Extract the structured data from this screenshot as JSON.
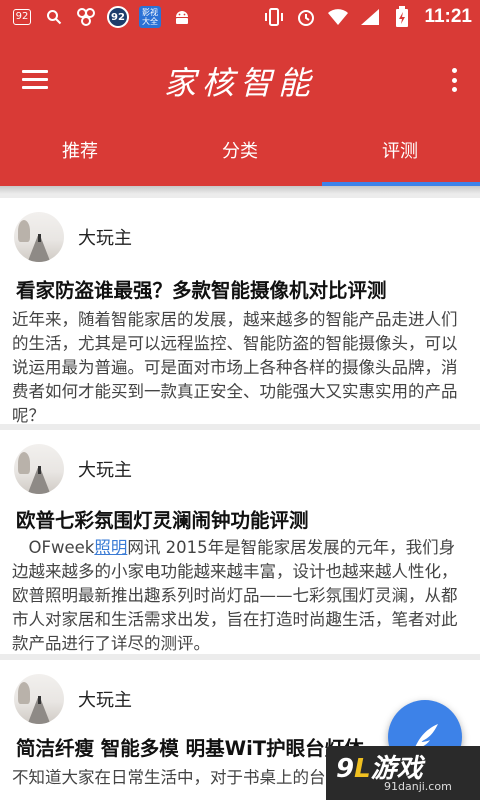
{
  "status_bar": {
    "left_icons": [
      "notification-92-icon",
      "search-icon",
      "app-icon",
      "speed-92-icon",
      "video-app-icon",
      "android-icon"
    ],
    "badge_text": "92",
    "circle_text": "92",
    "app_text": "影视大全",
    "right_icons": [
      "vibrate-icon",
      "alarm-icon",
      "wifi-icon",
      "signal-icon",
      "battery-icon"
    ],
    "time": "11:21"
  },
  "appbar": {
    "title": "家核智能",
    "background": "#d93a36"
  },
  "tabs": [
    {
      "label": "推荐",
      "active": false
    },
    {
      "label": "分类",
      "active": false
    },
    {
      "label": "评测",
      "active": true
    }
  ],
  "tab_indicator_color": "#3d82e8",
  "articles": [
    {
      "author": "大玩主",
      "title": "看家防盗谁最强？多款智能摄像机对比评测",
      "body": "近年来，随着智能家居的发展，越来越多的智能产品走进人们的生活，尤其是可以远程监控、智能防盗的智能摄像头，可以说运用最为普遍。可是面对市场上各种各样的摄像头品牌，消费者如何才能买到一款真正安全、功能强大又实惠实用的产品呢？"
    },
    {
      "author": "大玩主",
      "title": "欧普七彩氛围灯灵澜闹钟功能评测",
      "body_prefix": "　OFweek",
      "body_link": "照明",
      "body_suffix": "网讯 2015年是智能家居发展的元年，我们身边越来越多的小家电功能越来越丰富，设计也越来越人性化，欧普照明最新推出趣系列时尚灯品——七彩氛围灯灵澜，从都市人对家居和生活需求出发，旨在打造时尚趣生活，笔者对此款产品进行了详尽的测评。"
    },
    {
      "author": "大玩主",
      "title": "简洁纤瘦 智能多模 明基WiT护眼台灯体",
      "body": "不知道大家在日常生活中，对于书桌上的台灯"
    }
  ],
  "fab": {
    "icon": "feather-icon",
    "color": "#3d82e8"
  },
  "watermark": {
    "main_prefix": "9",
    "main_letters": "L",
    "main_suffix": "游戏",
    "sub": "91danji.com"
  }
}
